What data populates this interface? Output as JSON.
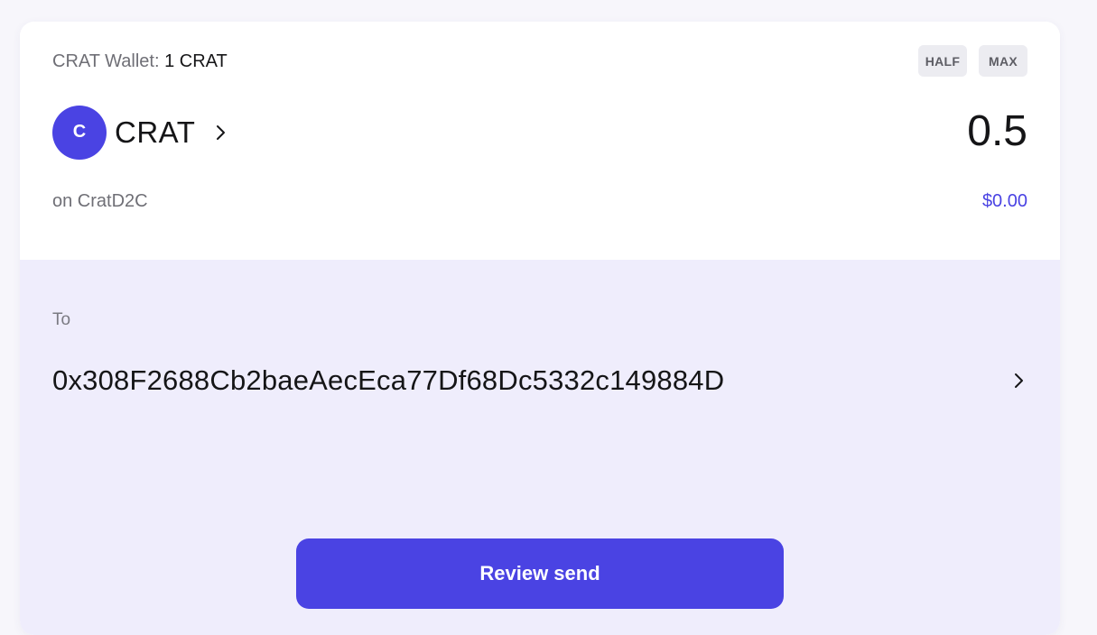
{
  "wallet": {
    "label": "CRAT Wallet:",
    "balance": "1 CRAT"
  },
  "quick_amount": {
    "half_label": "HALF",
    "max_label": "MAX"
  },
  "token": {
    "avatar_letter": "C",
    "symbol": "CRAT",
    "network": "on CratD2C",
    "avatar_color": "#4a43e3"
  },
  "amount": {
    "value": "0.5",
    "usd_value": "$0.00"
  },
  "recipient": {
    "label": "To",
    "address": "0x308F2688Cb2baeAecEca77Df68Dc5332c149884D"
  },
  "actions": {
    "review_label": "Review send"
  },
  "colors": {
    "accent": "#4a43e3",
    "recipient_background": "#efedfc",
    "pill_background": "#ececf1"
  },
  "icons": {
    "token_chevron": "chevron-right-icon",
    "address_chevron": "chevron-right-icon"
  }
}
